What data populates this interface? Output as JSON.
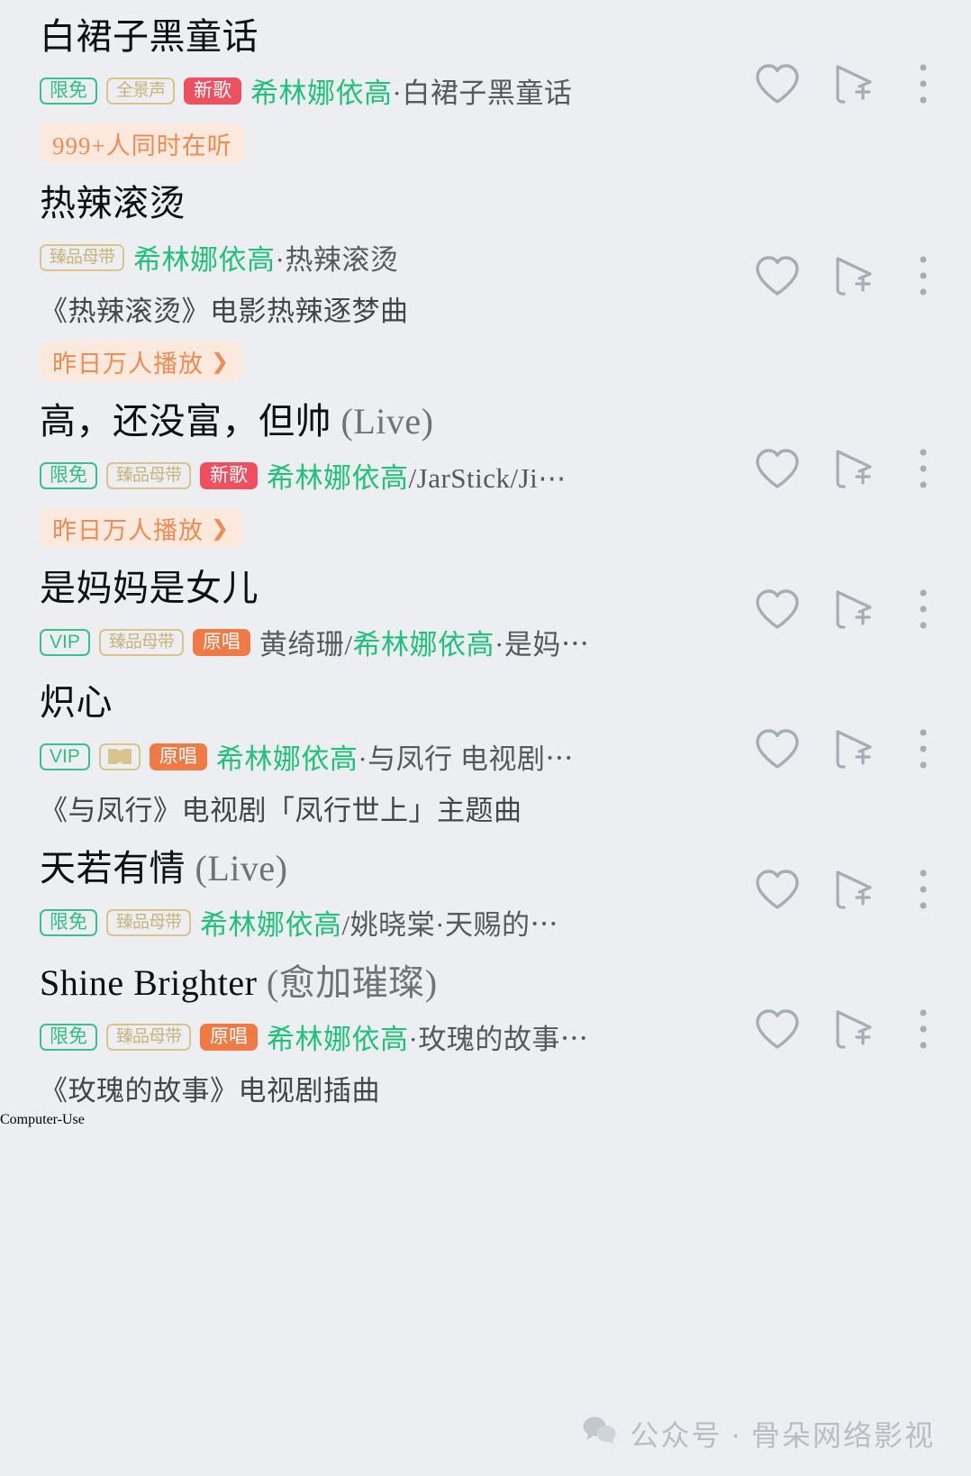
{
  "background_color": "#eceef1",
  "accent_colors": {
    "artist_highlight": "#1fc17b",
    "tag_green": "#2fbf86",
    "tag_gold": "#c9b47c",
    "tag_red": "#ef5060",
    "tag_orange": "#f07a45",
    "badge_text": "#ef8c54",
    "badge_bg": "#fbe9dd",
    "icon_gray": "#9aa0a6"
  },
  "actions": {
    "favorite_label": "heart-icon",
    "add_to_playlist_label": "play-add-icon",
    "more_label": "more-vertical-icon"
  },
  "songs": [
    {
      "title": "白裙子黑童话",
      "title_suffix": "",
      "tags": [
        {
          "text": "限免",
          "style": "outline-green"
        },
        {
          "text": "全景声",
          "style": "outline-gold"
        },
        {
          "text": "新歌",
          "style": "solid-red"
        }
      ],
      "artist_highlight": "希林娜依高",
      "artist_rest": "·白裙子黑童话",
      "sub_line": "",
      "badge": "999+人同时在听",
      "badge_chevron": ""
    },
    {
      "title": "热辣滚烫",
      "title_suffix": "",
      "tags": [
        {
          "text": "臻品母带",
          "style": "outline-gold"
        }
      ],
      "artist_highlight": "希林娜依高",
      "artist_rest": "·热辣滚烫",
      "sub_line": "《热辣滚烫》电影热辣逐梦曲",
      "badge": "昨日万人播放",
      "badge_chevron": "❯"
    },
    {
      "title": "高，还没富，但帅",
      "title_suffix": " (Live)",
      "tags": [
        {
          "text": "限免",
          "style": "outline-green"
        },
        {
          "text": "臻品母带",
          "style": "outline-gold"
        },
        {
          "text": "新歌",
          "style": "solid-red"
        }
      ],
      "artist_highlight": "希林娜依高",
      "artist_rest": "/JarStick/Ji⋯",
      "sub_line": "",
      "badge": "昨日万人播放",
      "badge_chevron": "❯"
    },
    {
      "title": "是妈妈是女儿",
      "title_suffix": "",
      "tags": [
        {
          "text": "VIP",
          "style": "outline-green"
        },
        {
          "text": "臻品母带",
          "style": "outline-gold"
        },
        {
          "text": "原唱",
          "style": "solid-orange"
        }
      ],
      "artist_prefix": "黄绮珊/",
      "artist_highlight": "希林娜依高",
      "artist_rest": "·是妈⋯",
      "sub_line": "",
      "badge": "",
      "badge_chevron": ""
    },
    {
      "title": "炽心",
      "title_suffix": "",
      "tags": [
        {
          "text": "VIP",
          "style": "outline-green"
        },
        {
          "text": "dolby-atmos-icon",
          "style": "dolby"
        },
        {
          "text": "原唱",
          "style": "solid-orange"
        }
      ],
      "artist_highlight": "希林娜依高",
      "artist_rest": "·与凤行 电视剧⋯",
      "sub_line": "《与凤行》电视剧「凤行世上」主题曲",
      "badge": "",
      "badge_chevron": ""
    },
    {
      "title": "天若有情",
      "title_suffix": " (Live)",
      "tags": [
        {
          "text": "限免",
          "style": "outline-green"
        },
        {
          "text": "臻品母带",
          "style": "outline-gold"
        }
      ],
      "artist_highlight": "希林娜依高",
      "artist_rest": "/姚晓棠·天赐的⋯",
      "sub_line": "",
      "badge": "",
      "badge_chevron": ""
    },
    {
      "title": "Shine Brighter",
      "title_suffix": " (愈加璀璨)",
      "tags": [
        {
          "text": "限免",
          "style": "outline-green"
        },
        {
          "text": "臻品母带",
          "style": "outline-gold"
        },
        {
          "text": "原唱",
          "style": "solid-orange"
        }
      ],
      "artist_highlight": "希林娜依高",
      "artist_rest": "·玫瑰的故事⋯",
      "sub_line": "《玫瑰的故事》电视剧插曲",
      "badge": "",
      "badge_chevron": ""
    }
  ],
  "watermark": {
    "icon": "wechat-icon",
    "text": "公众号 · 骨朵网络影视"
  }
}
